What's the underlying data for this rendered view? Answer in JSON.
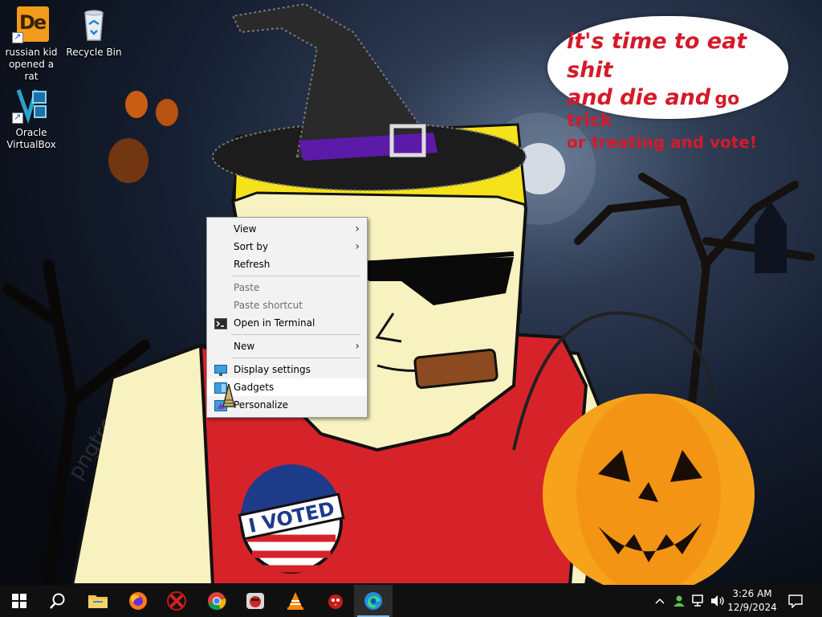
{
  "desktop": {
    "icons": [
      {
        "label": "russian kid opened a rat",
        "icon": "de-app-icon"
      },
      {
        "label": "Recycle Bin",
        "icon": "recycle-bin-icon"
      },
      {
        "label": "Oracle VirtualBox",
        "icon": "virtualbox-icon"
      }
    ]
  },
  "wallpaper": {
    "bubble_line1": "it's time to eat shit",
    "bubble_line2a": "and die and",
    "bubble_line2b": "go trick",
    "bubble_line3": "or treating and vote!",
    "badge_text": "I VOTED",
    "watermark": "pngtree"
  },
  "context_menu": {
    "items": [
      {
        "label": "View",
        "has_submenu": true
      },
      {
        "label": "Sort by",
        "has_submenu": true
      },
      {
        "label": "Refresh"
      },
      {
        "label": "Paste",
        "disabled": true
      },
      {
        "label": "Paste shortcut",
        "disabled": true
      },
      {
        "label": "Open in Terminal",
        "icon": "terminal-icon"
      },
      {
        "label": "New",
        "has_submenu": true
      },
      {
        "label": "Display settings",
        "icon": "display-icon"
      },
      {
        "label": "Gadgets",
        "icon": "gadgets-icon",
        "hovered": true
      },
      {
        "label": "Personalize",
        "icon": "personalize-icon"
      }
    ]
  },
  "taskbar": {
    "apps": [
      "start",
      "search",
      "file-explorer",
      "firefox",
      "red-app",
      "chrome",
      "angry-birds",
      "vlc",
      "red-bird",
      "edge"
    ],
    "clock_time": "3:26 AM",
    "clock_date": "12/9/2024"
  },
  "colors": {
    "taskbar_bg": "#101010",
    "menu_bg": "#f2f2f2",
    "bubble_text": "#d41a2a",
    "accent": "#76b9ed"
  }
}
